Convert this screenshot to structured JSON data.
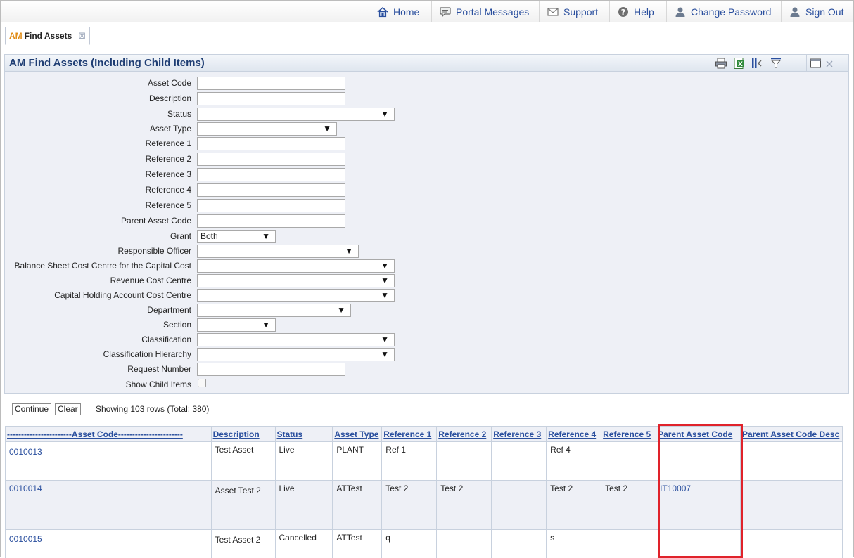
{
  "nav": {
    "items": [
      {
        "label": "Home",
        "icon": "home-icon"
      },
      {
        "label": "Portal Messages",
        "icon": "messages-icon"
      },
      {
        "label": "Support",
        "icon": "mail-icon"
      },
      {
        "label": "Help",
        "icon": "help-icon"
      },
      {
        "label": "Change Password",
        "icon": "user-icon"
      },
      {
        "label": "Sign Out",
        "icon": "user-icon"
      }
    ]
  },
  "tab": {
    "prefix": "AM",
    "label": "Find Assets",
    "close": "⊠"
  },
  "panel": {
    "title": "AM Find Assets (Including Child Items)"
  },
  "form": {
    "asset_code": "Asset Code",
    "description": "Description",
    "status": "Status",
    "asset_type": "Asset Type",
    "reference_1": "Reference 1",
    "reference_2": "Reference 2",
    "reference_3": "Reference 3",
    "reference_4": "Reference 4",
    "reference_5": "Reference 5",
    "parent_asset_code": "Parent Asset Code",
    "grant": "Grant",
    "grant_value": "Both",
    "responsible_officer": "Responsible Officer",
    "balance_sheet": "Balance Sheet Cost Centre for the Capital Cost",
    "revenue_cc": "Revenue Cost Centre",
    "capital_holding": "Capital Holding Account Cost Centre",
    "department": "Department",
    "section": "Section",
    "classification": "Classification",
    "classification_hierarchy": "Classification Hierarchy",
    "request_number": "Request Number",
    "show_child_items": "Show Child Items",
    "arrow": "▼"
  },
  "actions": {
    "continue": "Continue",
    "clear": "Clear",
    "status": "Showing 103 rows (Total: 380)"
  },
  "table": {
    "headers": [
      "-----------------------Asset Code-----------------------",
      "Description",
      "Status",
      "Asset Type",
      "Reference 1",
      "Reference 2",
      "Reference 3",
      "Reference 4",
      "Reference 5",
      "Parent Asset Code",
      "Parent Asset Code Desc"
    ],
    "rows": [
      {
        "asset_code": "0010013",
        "description": "Test Asset",
        "status": "Live",
        "asset_type": "PLANT",
        "ref1": "Ref 1",
        "ref2": "",
        "ref3": "",
        "ref4": "Ref 4",
        "ref5": "",
        "parent": "",
        "parent_desc": ""
      },
      {
        "asset_code": "0010014",
        "description": "Asset Test 2",
        "status": "Live",
        "asset_type": "ATTest",
        "ref1": "Test 2",
        "ref2": "Test 2",
        "ref3": "",
        "ref4": "Test 2",
        "ref5": "Test 2",
        "parent": "IT10007",
        "parent_desc": ""
      },
      {
        "asset_code": "0010015",
        "description": "Test Asset 2",
        "status": "Cancelled",
        "asset_type": "ATTest",
        "ref1": "q",
        "ref2": "",
        "ref3": "",
        "ref4": "s",
        "ref5": "",
        "parent": "",
        "parent_desc": ""
      }
    ]
  },
  "colors": {
    "link": "#2a4f9e",
    "accent": "#e08a12",
    "highlight": "#e0222a"
  }
}
